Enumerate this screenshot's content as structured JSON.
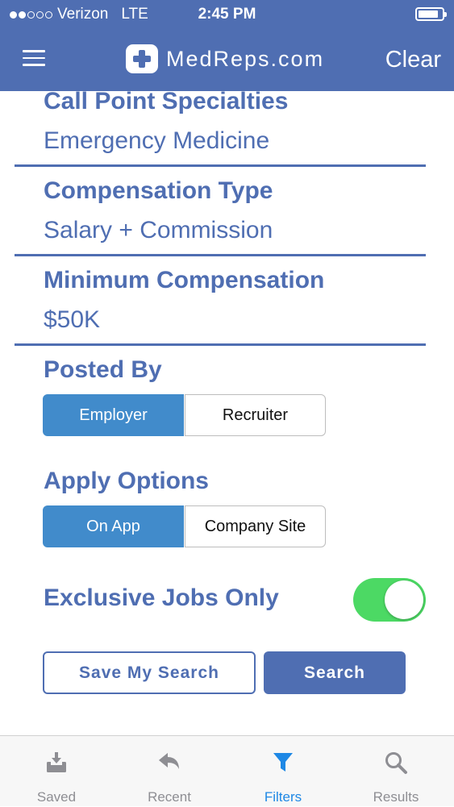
{
  "status_bar": {
    "carrier": "Verizon",
    "network": "LTE",
    "time": "2:45 PM",
    "signal_bars_filled": 2,
    "signal_bars_total": 5,
    "battery_level": 0.85
  },
  "header": {
    "logo_text": "MedReps.com",
    "clear_label": "Clear",
    "menu_icon": "hamburger-menu-icon",
    "background_color": "#4f6eb2"
  },
  "filters": {
    "call_point": {
      "label": "Call Point Specialties",
      "value": "Emergency Medicine"
    },
    "compensation_type": {
      "label": "Compensation Type",
      "value": "Salary + Commission"
    },
    "minimum_compensation": {
      "label": "Minimum Compensation",
      "value": "$50K"
    },
    "posted_by": {
      "label": "Posted By",
      "options": [
        "Employer",
        "Recruiter"
      ],
      "selected": "Employer"
    },
    "apply_options": {
      "label": "Apply Options",
      "options": [
        "On App",
        "Company Site"
      ],
      "selected": "On App"
    },
    "exclusive_jobs": {
      "label": "Exclusive Jobs Only",
      "enabled": true
    }
  },
  "actions": {
    "save_search_label": "Save My Search",
    "search_label": "Search"
  },
  "tabbar": {
    "tabs": [
      {
        "label": "Saved",
        "icon": "saved-tray-icon"
      },
      {
        "label": "Recent",
        "icon": "reply-arrow-icon"
      },
      {
        "label": "Filters",
        "icon": "funnel-icon"
      },
      {
        "label": "Results",
        "icon": "magnifier-icon"
      }
    ],
    "active": "Filters",
    "active_color": "#1e88e5"
  }
}
